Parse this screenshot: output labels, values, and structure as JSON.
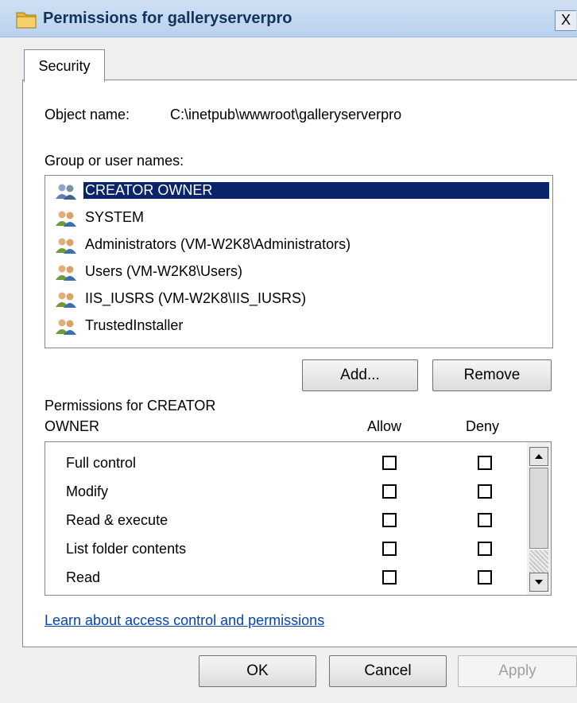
{
  "window": {
    "title": "Permissions for galleryserverpro",
    "close_glyph": "X"
  },
  "tabs": [
    {
      "label": "Security",
      "active": true
    }
  ],
  "object": {
    "label": "Object name:",
    "value": "C:\\inetpub\\wwwroot\\galleryserverpro"
  },
  "groups": {
    "label": "Group or user names:",
    "items": [
      {
        "name": "CREATOR OWNER",
        "icon": "users-icon",
        "selected": true
      },
      {
        "name": "SYSTEM",
        "icon": "users-icon",
        "selected": false
      },
      {
        "name": "Administrators (VM-W2K8\\Administrators)",
        "icon": "users-icon",
        "selected": false
      },
      {
        "name": "Users (VM-W2K8\\Users)",
        "icon": "users-icon",
        "selected": false
      },
      {
        "name": "IIS_IUSRS (VM-W2K8\\IIS_IUSRS)",
        "icon": "users-icon",
        "selected": false
      },
      {
        "name": "TrustedInstaller",
        "icon": "users-icon",
        "selected": false
      }
    ],
    "add_label": "Add...",
    "remove_label": "Remove"
  },
  "permissions": {
    "label_line1": "Permissions for CREATOR",
    "label_line2": "OWNER",
    "allow_label": "Allow",
    "deny_label": "Deny",
    "rows": [
      {
        "name": "Full control",
        "allow": false,
        "deny": false
      },
      {
        "name": "Modify",
        "allow": false,
        "deny": false
      },
      {
        "name": "Read & execute",
        "allow": false,
        "deny": false
      },
      {
        "name": "List folder contents",
        "allow": false,
        "deny": false
      },
      {
        "name": "Read",
        "allow": false,
        "deny": false
      }
    ]
  },
  "link_text": "Learn about access control and permissions",
  "footer": {
    "ok_label": "OK",
    "cancel_label": "Cancel",
    "apply_label": "Apply",
    "apply_enabled": false
  },
  "colors": {
    "selection": "#0a246a",
    "title_text": "#13335a",
    "link": "#0645ad"
  }
}
